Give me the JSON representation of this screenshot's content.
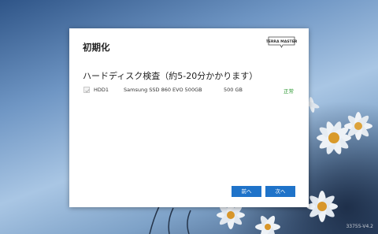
{
  "dialog": {
    "title": "初期化",
    "logo_text": "TERRA MASTER",
    "heading": "ハードディスク検査（約5-20分かかります）"
  },
  "disks": [
    {
      "name": "HDD1",
      "model": "Samsung SSD 860 EVO 500GB",
      "size": "500 GB",
      "status": "正常",
      "checked": true
    }
  ],
  "buttons": {
    "prev": "前へ",
    "next": "次へ"
  },
  "version": "33755-V4.2",
  "colors": {
    "accent": "#1f73c9",
    "status_ok": "#2e9a33"
  }
}
